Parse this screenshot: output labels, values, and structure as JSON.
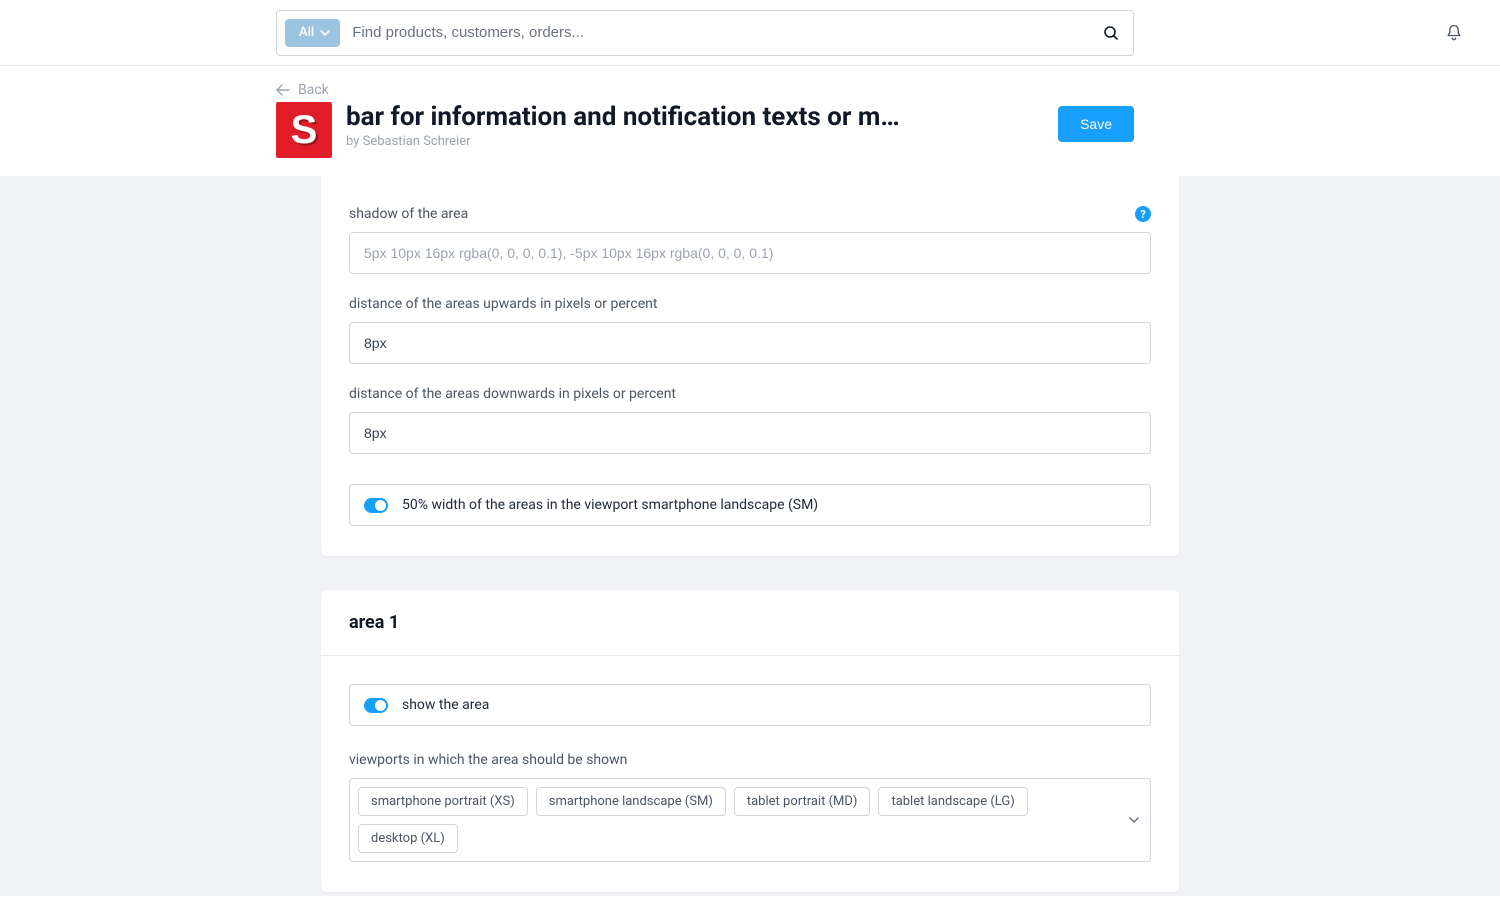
{
  "topbar": {
    "filter_label": "All",
    "search_placeholder": "Find products, customers, orders..."
  },
  "header": {
    "back_label": "Back",
    "app_icon_letter": "S",
    "title": "bar for information and notification texts or m…",
    "byline": "by Sebastian Schreier",
    "save_label": "Save"
  },
  "card1": {
    "field_shadow_label": "shadow of the area",
    "field_shadow_placeholder": "5px 10px 16px rgba(0, 0, 0, 0.1), -5px 10px 16px rgba(0, 0, 0, 0.1)",
    "field_dist_up_label": "distance of the areas upwards in pixels or percent",
    "field_dist_up_value": "8px",
    "field_dist_down_label": "distance of the areas downwards in pixels or percent",
    "field_dist_down_value": "8px",
    "toggle1_label": "50% width of the areas in the viewport smartphone landscape (SM)"
  },
  "card2": {
    "title": "area 1",
    "toggle_show_label": "show the area",
    "viewports_label": "viewports in which the area should be shown",
    "viewports": [
      "smartphone portrait (XS)",
      "smartphone landscape (SM)",
      "tablet portrait (MD)",
      "tablet landscape (LG)",
      "desktop (XL)"
    ]
  }
}
